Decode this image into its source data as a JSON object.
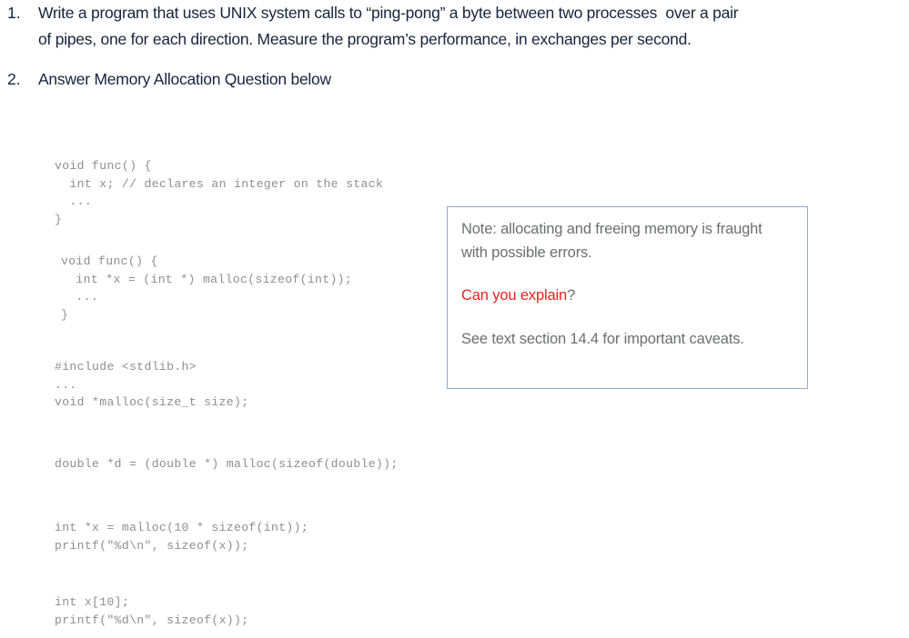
{
  "page": {
    "background_color": "#ffffff",
    "text_color": "#16243c",
    "code_color": "#8e8e93",
    "note_text_color": "#6d6e71",
    "note_accent_color": "#e8201e",
    "note_border_color": "#8faccb"
  },
  "questions": [
    {
      "number": "1.",
      "text": "Write a program that uses UNIX system calls to “ping-pong” a byte between two processes  over a pair of pipes, one for each direction. Measure the program’s performance, in exchanges per second."
    },
    {
      "number": "2.",
      "text": "Answer Memory Allocation Question below"
    }
  ],
  "code_blocks": [
    {
      "id": "code-block-1",
      "lines": [
        "void func() {",
        "  int x; // declares an integer on the stack",
        "  ...",
        "}"
      ]
    },
    {
      "id": "code-block-2",
      "lines": [
        "void func() {",
        "  int *x = (int *) malloc(sizeof(int));",
        "  ...",
        "}"
      ]
    },
    {
      "id": "code-block-3",
      "lines": [
        "#include <stdlib.h>",
        "...",
        "void *malloc(size_t size);"
      ]
    },
    {
      "id": "code-block-4",
      "lines": [
        "double *d = (double *) malloc(sizeof(double));"
      ]
    },
    {
      "id": "code-block-5",
      "lines": [
        "int *x = malloc(10 * sizeof(int));",
        "printf(\"%d\\n\", sizeof(x));"
      ]
    },
    {
      "id": "code-block-6",
      "lines": [
        "int x[10];",
        "printf(\"%d\\n\", sizeof(x));"
      ]
    }
  ],
  "note_box": {
    "paragraph_1": "Note: allocating and freeing memory is fraught with possible errors.",
    "paragraph_2_accent": "Can you explain",
    "paragraph_2_tail": "?",
    "paragraph_3": "See text section 14.4 for important caveats."
  }
}
